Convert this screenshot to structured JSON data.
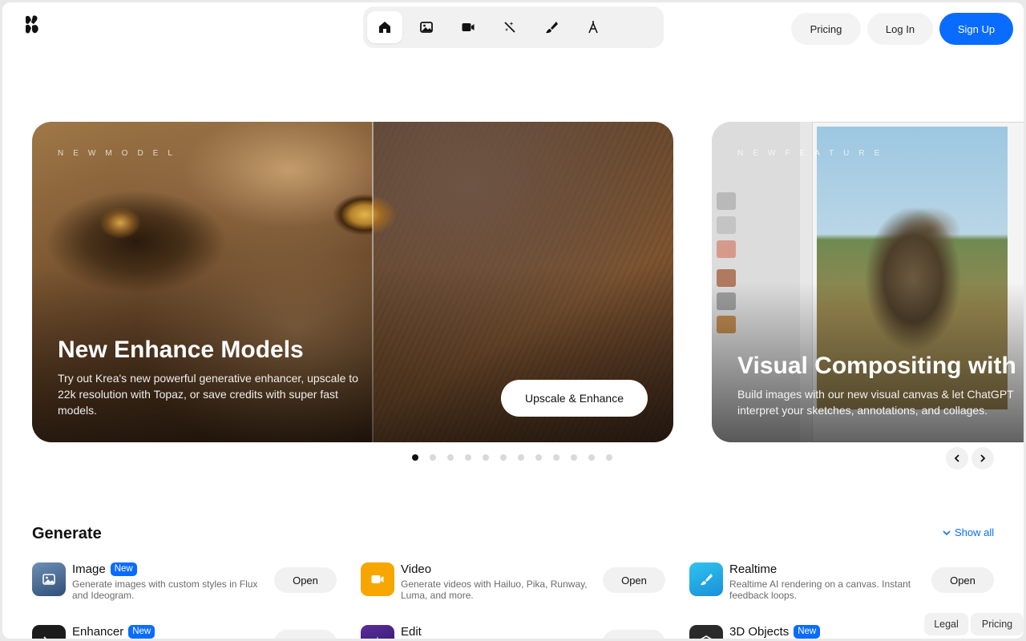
{
  "header": {
    "logo_icon": "krea-logo-icon",
    "nav_items": [
      {
        "icon": "home-icon",
        "active": true
      },
      {
        "icon": "image-icon",
        "active": false
      },
      {
        "icon": "video-camera-icon",
        "active": false
      },
      {
        "icon": "magic-wand-icon",
        "active": false
      },
      {
        "icon": "brush-icon",
        "active": false
      },
      {
        "icon": "pen-nib-icon",
        "active": false
      }
    ],
    "pricing_label": "Pricing",
    "login_label": "Log In",
    "signup_label": "Sign Up",
    "accent_color": "#0a6cff"
  },
  "hero": {
    "slides": [
      {
        "eyebrow": "NEWMODEL",
        "title": "New Enhance Models",
        "description": "Try out Krea's new powerful generative enhancer, upscale to 22k resolution with Topaz, or save credits with super fast models.",
        "cta": "Upscale & Enhance"
      },
      {
        "eyebrow": "NEWFEATURE",
        "title": "Visual Compositing with C",
        "description": "Build images with our new visual canvas & let ChatGPT interpret your sketches, annotations, and collages."
      }
    ],
    "dot_count": 12,
    "active_dot": 0,
    "prev_icon": "chevron-left-icon",
    "next_icon": "chevron-right-icon"
  },
  "generate": {
    "title": "Generate",
    "show_all": "Show all",
    "tools": [
      {
        "name": "Image",
        "badge": "New",
        "description": "Generate images with custom styles in Flux and Ideogram.",
        "action": "Open",
        "icon": "image-icon"
      },
      {
        "name": "Video",
        "badge": "",
        "description": "Generate videos with Hailuo, Pika, Runway, Luma, and more.",
        "action": "Open",
        "icon": "video-camera-icon"
      },
      {
        "name": "Realtime",
        "badge": "",
        "description": "Realtime AI rendering on a canvas. Instant feedback loops.",
        "action": "Open",
        "icon": "brush-icon"
      },
      {
        "name": "Enhancer",
        "badge": "New",
        "description": "",
        "action": "",
        "icon": "enhancer-icon"
      },
      {
        "name": "Edit",
        "badge": "",
        "description": "",
        "action": "",
        "icon": "sparkle-icon"
      },
      {
        "name": "3D Objects",
        "badge": "New",
        "description": "",
        "action": "",
        "icon": "cube-icon"
      }
    ]
  },
  "footer": {
    "legal": "Legal",
    "pricing": "Pricing"
  }
}
